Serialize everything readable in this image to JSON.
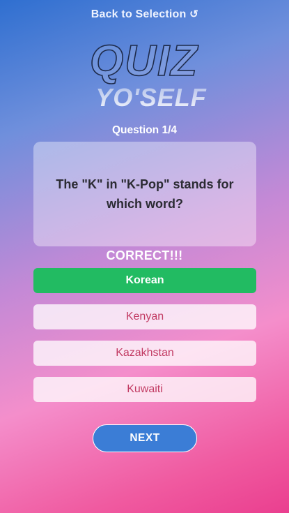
{
  "header": {
    "back_label": "Back to Selection",
    "back_icon": "refresh-icon"
  },
  "logo": {
    "line1": "QUIZ",
    "line2": "YO'SELF"
  },
  "question": {
    "counter": "Question 1/4",
    "text": "The \"K\" in \"K-Pop\" stands for which word?"
  },
  "feedback": "CORRECT!!!",
  "options": [
    {
      "label": "Korean",
      "state": "correct"
    },
    {
      "label": "Kenyan",
      "state": "neutral"
    },
    {
      "label": "Kazakhstan",
      "state": "neutral"
    },
    {
      "label": "Kuwaiti",
      "state": "neutral"
    }
  ],
  "next_label": "NEXT",
  "colors": {
    "correct": "#22bb62",
    "option_text": "#c23b63",
    "next_button": "#3b7dd6",
    "gradient_start": "#2f6fd0",
    "gradient_end": "#ea3f8f"
  }
}
